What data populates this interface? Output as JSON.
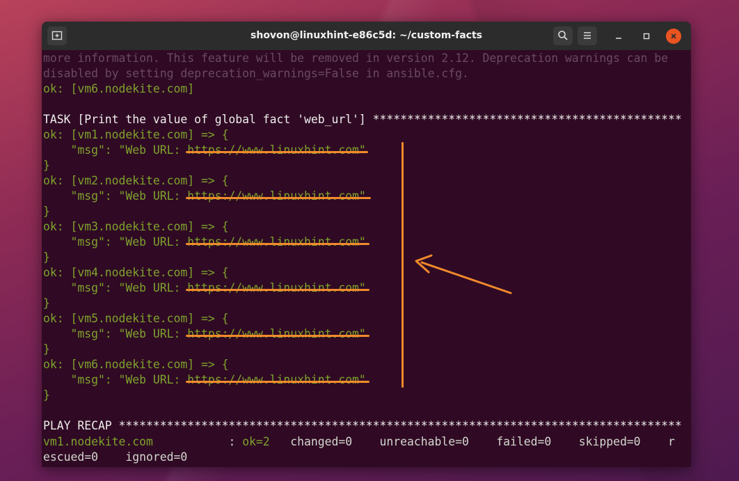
{
  "window": {
    "title": "shovon@linuxhint-e86c5d: ~/custom-facts",
    "new_tab_icon": "new-tab-icon",
    "search_icon": "search-icon",
    "menu_icon": "hamburger-menu-icon"
  },
  "terminal": {
    "lines": [
      {
        "text": "more information. This feature will be removed in version 2.12. Deprecation warnings can be",
        "style": "dim"
      },
      {
        "text": "disabled by setting deprecation_warnings=False in ansible.cfg.",
        "style": "dim"
      },
      {
        "text": "ok: [vm6.nodekite.com]",
        "style": "green"
      },
      {
        "text": "",
        "style": "green"
      },
      {
        "text": "TASK [Print the value of global fact 'web_url'] *********************************************",
        "style": "white"
      },
      {
        "text": "ok: [vm1.nodekite.com] => {",
        "style": "green"
      },
      {
        "text": "    \"msg\": \"Web URL: https://www.linuxhint.com\"",
        "style": "green"
      },
      {
        "text": "}",
        "style": "green"
      },
      {
        "text": "ok: [vm2.nodekite.com] => {",
        "style": "green"
      },
      {
        "text": "    \"msg\": \"Web URL: https://www.linuxhint.com\"",
        "style": "green"
      },
      {
        "text": "}",
        "style": "green"
      },
      {
        "text": "ok: [vm3.nodekite.com] => {",
        "style": "green"
      },
      {
        "text": "    \"msg\": \"Web URL: https://www.linuxhint.com\"",
        "style": "green"
      },
      {
        "text": "}",
        "style": "green"
      },
      {
        "text": "ok: [vm4.nodekite.com] => {",
        "style": "green"
      },
      {
        "text": "    \"msg\": \"Web URL: https://www.linuxhint.com\"",
        "style": "green"
      },
      {
        "text": "}",
        "style": "green"
      },
      {
        "text": "ok: [vm5.nodekite.com] => {",
        "style": "green"
      },
      {
        "text": "    \"msg\": \"Web URL: https://www.linuxhint.com\"",
        "style": "green"
      },
      {
        "text": "}",
        "style": "green"
      },
      {
        "text": "ok: [vm6.nodekite.com] => {",
        "style": "green"
      },
      {
        "text": "    \"msg\": \"Web URL: https://www.linuxhint.com\"",
        "style": "green"
      },
      {
        "text": "}",
        "style": "green"
      },
      {
        "text": "",
        "style": "green"
      },
      {
        "text": "PLAY RECAP **********************************************************************************",
        "style": "white"
      }
    ],
    "recap_host": "vm1.nodekite.com",
    "recap_ok": "ok=2",
    "recap_rest": "   changed=0    unreachable=0    failed=0    skipped=0    r",
    "recap_wrap": "escued=0    ignored=0"
  },
  "colors": {
    "terminal_bg": "#300a24",
    "ok_green": "#7ea32c",
    "annotation_orange": "#f08a2c"
  }
}
